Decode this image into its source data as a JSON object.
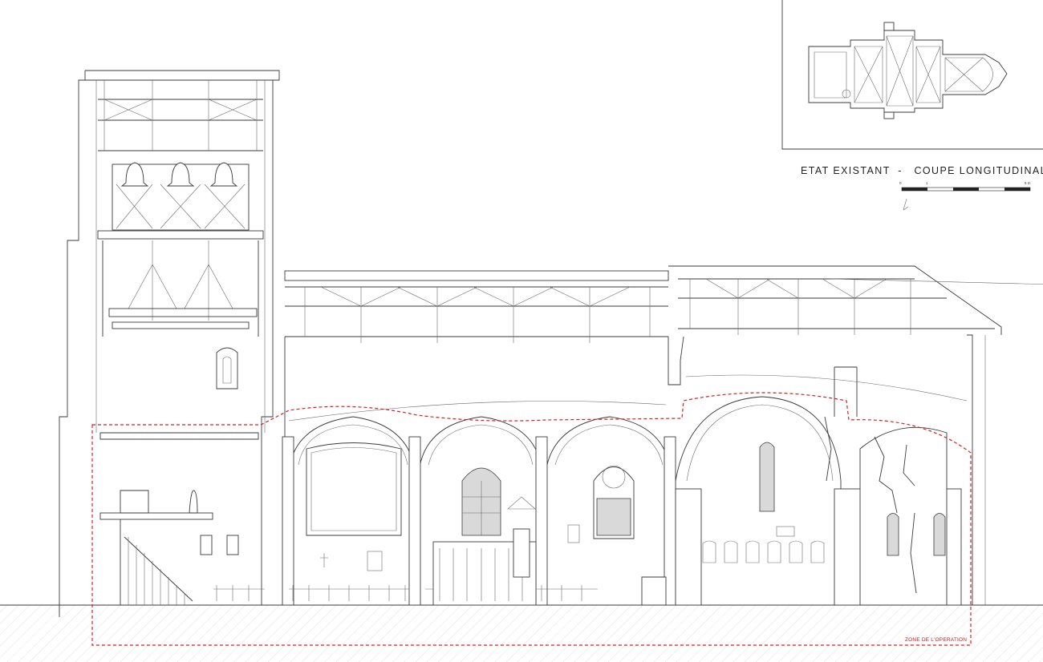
{
  "title": {
    "part1": "ETAT EXISTANT",
    "separator": "-",
    "part2": "COUPE LONGITUDINALE A"
  },
  "scale_bar": {
    "start": "0",
    "mid": "1",
    "end": "5 m"
  },
  "zone_label": "ZONE DE L'OPERATION",
  "colors": {
    "line": "#3a3a3a",
    "zone": "#d42020",
    "glass": "#d9d9d9"
  }
}
